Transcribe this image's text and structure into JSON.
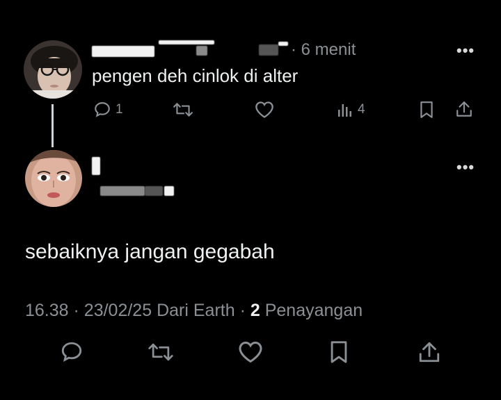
{
  "reply": {
    "time": "· 6 menit",
    "text": "pengen deh cinlok di alter",
    "actions": {
      "reply_count": "1",
      "repost_count": "",
      "like_count": "",
      "views_count": "4"
    }
  },
  "quoted": {
    "text": "sebaiknya jangan gegabah",
    "time": "16.38",
    "date": "23/02/25",
    "source": "Dari Earth",
    "views_count": "2",
    "views_label": "Penayangan"
  },
  "icons": {
    "reply": "reply-icon",
    "repost": "repost-icon",
    "like": "heart-icon",
    "views": "views-icon",
    "bookmark": "bookmark-icon",
    "share": "share-icon",
    "more": "more-icon"
  }
}
